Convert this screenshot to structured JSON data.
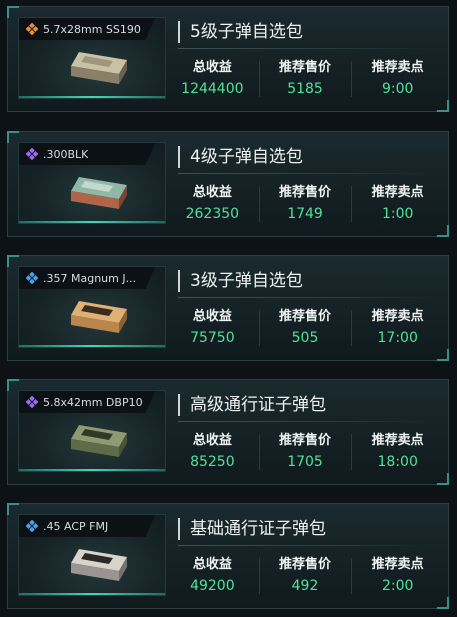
{
  "labels": {
    "revenue": "总收益",
    "price": "推荐售价",
    "time": "推荐卖点"
  },
  "colors": {
    "accent_green": "#4fe29a",
    "legendary": "#f08c3a",
    "epic": "#9b6cf0",
    "rare": "#4aa3e8"
  },
  "cards": [
    {
      "rarity_icon": "orange-diamond-cluster-icon",
      "item_name": "5.7x28mm SS190",
      "title": "5级子弹自选包",
      "revenue": "1244400",
      "price": "5185",
      "time": "9:00"
    },
    {
      "rarity_icon": "purple-diamond-cluster-icon",
      "item_name": ".300BLK",
      "title": "4级子弹自选包",
      "revenue": "262350",
      "price": "1749",
      "time": "1:00"
    },
    {
      "rarity_icon": "blue-diamond-cluster-icon",
      "item_name": ".357 Magnum J...",
      "title": "3级子弹自选包",
      "revenue": "75750",
      "price": "505",
      "time": "17:00"
    },
    {
      "rarity_icon": "purple-diamond-cluster-icon",
      "item_name": "5.8x42mm DBP10",
      "title": "高级通行证子弹包",
      "revenue": "85250",
      "price": "1705",
      "time": "18:00"
    },
    {
      "rarity_icon": "blue-diamond-cluster-icon",
      "item_name": ".45 ACP FMJ",
      "title": "基础通行证子弹包",
      "revenue": "49200",
      "price": "492",
      "time": "2:00"
    }
  ]
}
